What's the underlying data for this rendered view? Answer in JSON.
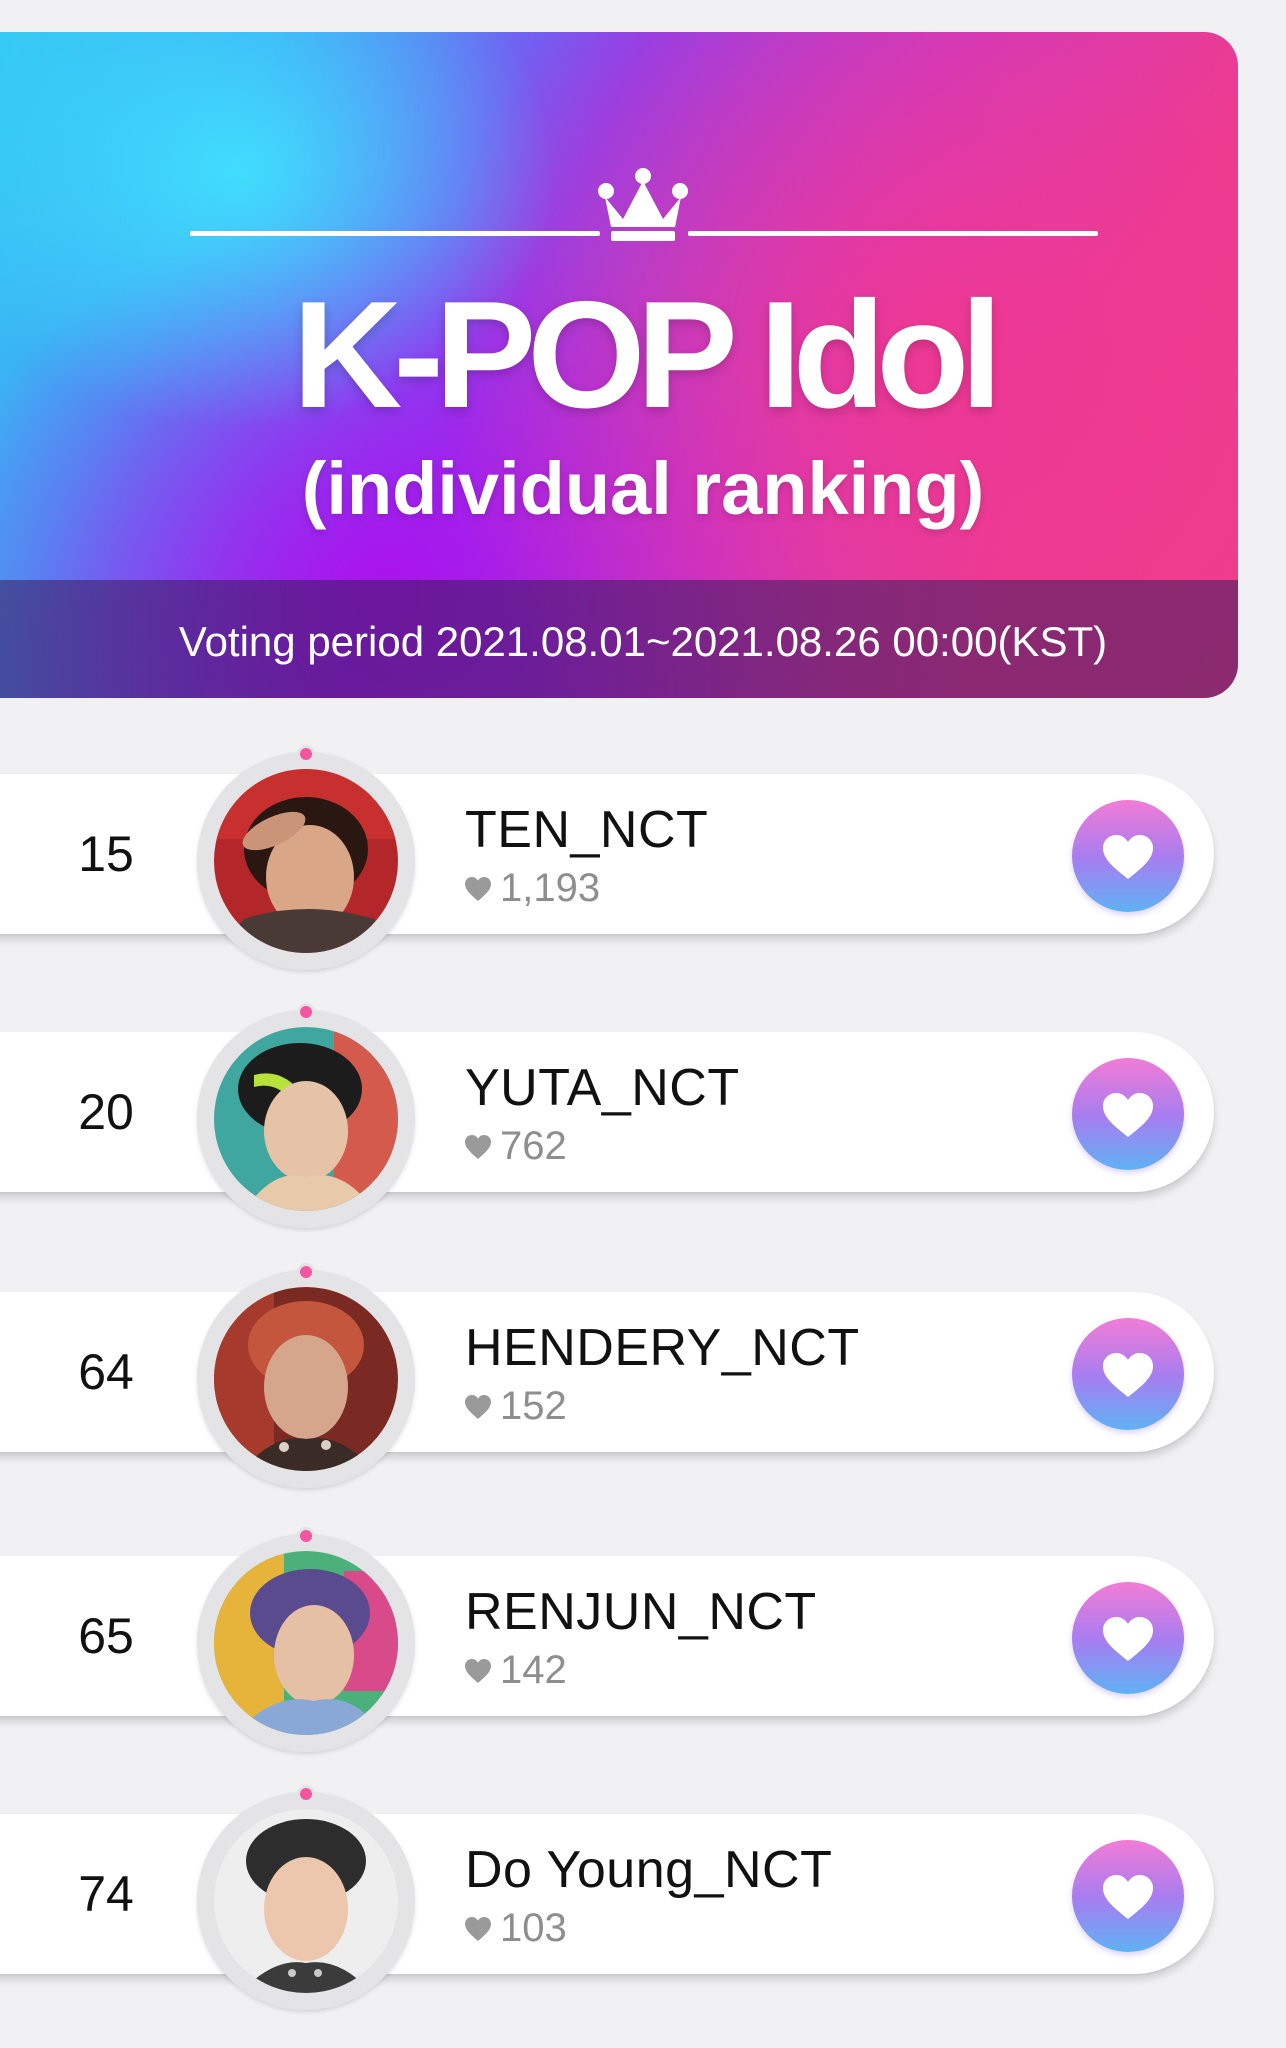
{
  "banner": {
    "title": "K-POP Idol",
    "subtitle": "(individual ranking)",
    "voting_period": "Voting period 2021.08.01~2021.08.26 00:00(KST)"
  },
  "rankings": [
    {
      "rank": "15",
      "name": "TEN_NCT",
      "votes": "1,193"
    },
    {
      "rank": "20",
      "name": "YUTA_NCT",
      "votes": "762"
    },
    {
      "rank": "64",
      "name": "HENDERY_NCT",
      "votes": "152"
    },
    {
      "rank": "65",
      "name": "RENJUN_NCT",
      "votes": "142"
    },
    {
      "rank": "74",
      "name": "Do Young_NCT",
      "votes": "103"
    }
  ],
  "icons": {
    "crown": "crown-icon",
    "vote_count": "heart-icon",
    "vote_button": "heart-icon"
  },
  "colors": {
    "banner_cyan": "#33c8f3",
    "banner_purple": "#ac10ec",
    "banner_pink": "#ef3f86",
    "vote_button_top": "#f27cd6",
    "vote_button_bottom": "#5fb2f4",
    "avatar_dot": "#f2569f"
  }
}
